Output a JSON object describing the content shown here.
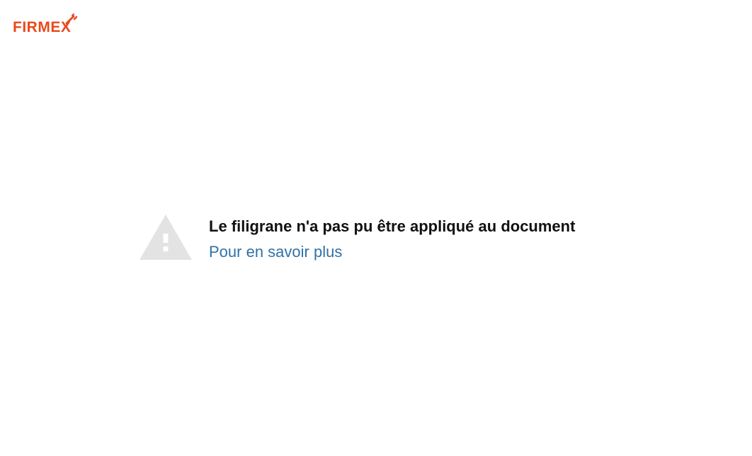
{
  "brand": {
    "logo_text": "FIRMEX",
    "color": "#e8491d"
  },
  "error": {
    "icon": "warning-triangle-icon",
    "icon_color": "#e3e3e3",
    "message": "Le filigrane n'a pas pu être appliqué au document",
    "learn_more_label": "Pour en savoir plus",
    "link_color": "#2f72a8"
  }
}
